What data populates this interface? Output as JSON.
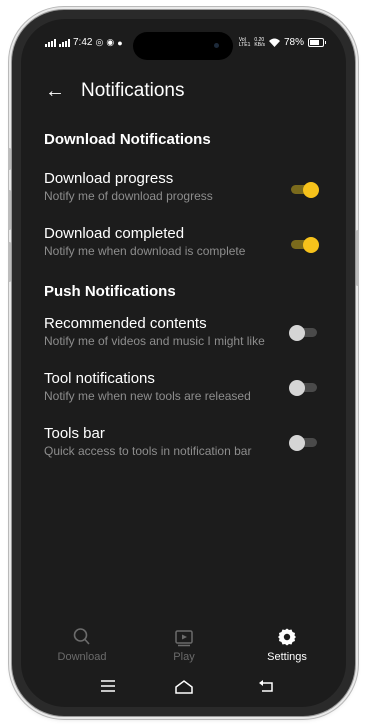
{
  "status_bar": {
    "time": "7:42",
    "battery": "78%",
    "network_label": "Vo) LTE1 0.20 KB/s"
  },
  "header": {
    "title": "Notifications",
    "back_icon": "arrow-left-icon"
  },
  "sections": {
    "download": {
      "title": "Download Notifications",
      "items": [
        {
          "title": "Download progress",
          "subtitle": "Notify me of download progress",
          "enabled": true
        },
        {
          "title": "Download completed",
          "subtitle": "Notify me when download is complete",
          "enabled": true
        }
      ]
    },
    "push": {
      "title": "Push Notifications",
      "items": [
        {
          "title": "Recommended contents",
          "subtitle": "Notify me of videos and music I might like",
          "enabled": false
        },
        {
          "title": "Tool notifications",
          "subtitle": "Notify me when new tools are released",
          "enabled": false
        },
        {
          "title": "Tools bar",
          "subtitle": "Quick access to tools in notification bar",
          "enabled": false
        }
      ]
    }
  },
  "bottom_nav": {
    "items": [
      {
        "label": "Download",
        "icon": "search-icon",
        "active": false
      },
      {
        "label": "Play",
        "icon": "play-library-icon",
        "active": false
      },
      {
        "label": "Settings",
        "icon": "gear-icon",
        "active": true
      }
    ]
  },
  "system_nav": {
    "items": [
      "menu-icon",
      "home-icon",
      "back-icon"
    ]
  },
  "colors": {
    "background": "#1c1c1c",
    "accent": "#f6c21b",
    "text_secondary": "#8d8d8d",
    "nav_inactive": "#6b6b6b"
  }
}
